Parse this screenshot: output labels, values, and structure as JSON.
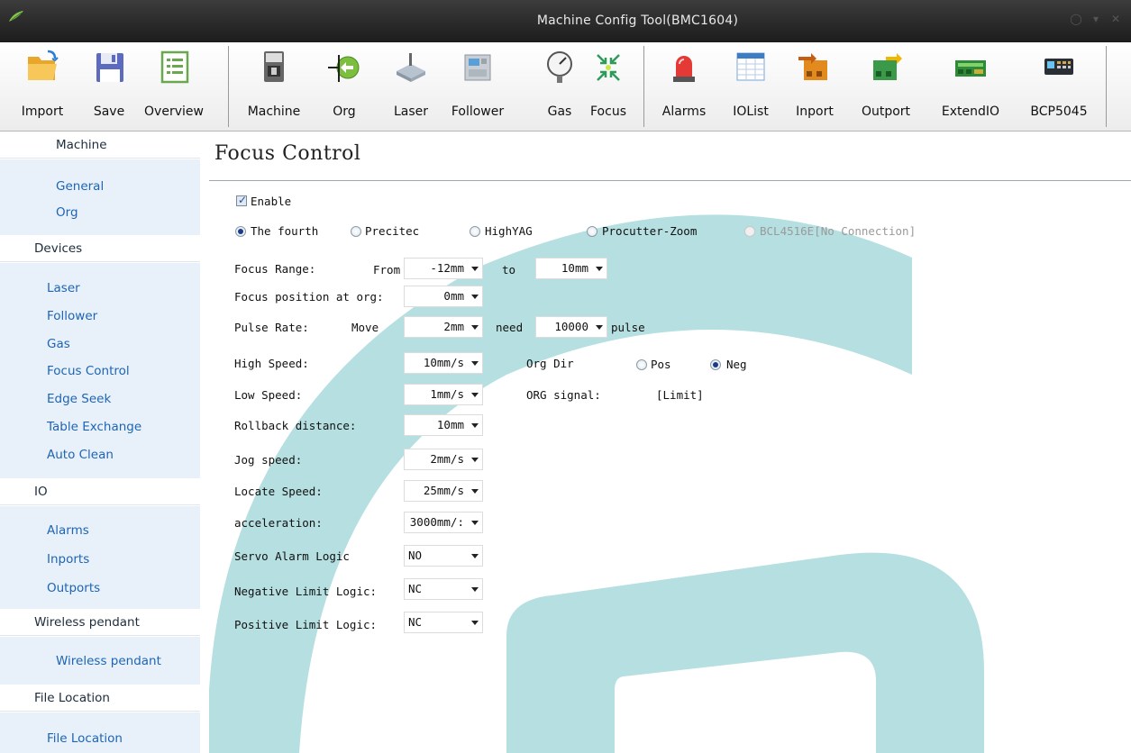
{
  "window": {
    "title": "Machine Config Tool(BMC1604)"
  },
  "toolbar": {
    "buttons": [
      {
        "label": "Import",
        "icon": "folder-open-icon"
      },
      {
        "label": "Save",
        "icon": "floppy-disk-icon"
      },
      {
        "label": "Overview",
        "icon": "list-document-icon"
      },
      {
        "label": "Machine",
        "icon": "machine-icon"
      },
      {
        "label": "Org",
        "icon": "origin-arrow-icon"
      },
      {
        "label": "Laser",
        "icon": "laser-icon"
      },
      {
        "label": "Follower",
        "icon": "follower-device-icon"
      },
      {
        "label": "Gas",
        "icon": "pressure-gauge-icon"
      },
      {
        "label": "Focus",
        "icon": "focus-arrows-icon"
      },
      {
        "label": "Alarms",
        "icon": "alarm-light-icon"
      },
      {
        "label": "IOList",
        "icon": "table-grid-icon"
      },
      {
        "label": "Inport",
        "icon": "inport-terminal-icon"
      },
      {
        "label": "Outport",
        "icon": "outport-terminal-icon"
      },
      {
        "label": "ExtendIO",
        "icon": "circuit-board-icon"
      },
      {
        "label": "BCP5045",
        "icon": "panel-display-icon"
      }
    ]
  },
  "sidebar": {
    "sections": [
      {
        "header": "Machine",
        "items": [
          "General",
          "Org"
        ]
      },
      {
        "header": "Devices",
        "items": [
          "Laser",
          "Follower",
          "Gas",
          "Focus Control",
          "Edge Seek",
          "Table Exchange",
          "Auto Clean"
        ]
      },
      {
        "header": "IO",
        "items": [
          "Alarms",
          "Inports",
          "Outports"
        ]
      },
      {
        "header": "Wireless pendant",
        "items": [
          "Wireless pendant"
        ]
      },
      {
        "header": "File Location",
        "items": [
          "File Location"
        ]
      }
    ]
  },
  "main": {
    "title": "Focus Control",
    "enable_label": "Enable",
    "enable_checked": true,
    "focus_types": [
      {
        "label": "The fourth",
        "selected": true,
        "enabled": true
      },
      {
        "label": "Precitec",
        "selected": false,
        "enabled": true
      },
      {
        "label": "HighYAG",
        "selected": false,
        "enabled": true
      },
      {
        "label": "Procutter-Zoom",
        "selected": false,
        "enabled": true
      },
      {
        "label": "BCL4516E[No Connection]",
        "selected": false,
        "enabled": false
      }
    ],
    "focus_range": {
      "label": "Focus Range:",
      "from_label": "From",
      "from_value": "-12mm",
      "to_label": "to",
      "to_value": "10mm"
    },
    "focus_pos_org": {
      "label": "Focus position at org:",
      "value": "0mm"
    },
    "pulse_rate": {
      "label": "Pulse Rate:",
      "move_label": "Move",
      "move_value": "2mm",
      "need_label": "need",
      "need_value": "10000",
      "pulse_label": "pulse"
    },
    "high_speed": {
      "label": "High Speed:",
      "value": "10mm/s"
    },
    "org_dir": {
      "label": "Org Dir",
      "pos_label": "Pos",
      "neg_label": "Neg",
      "selected": "Neg"
    },
    "low_speed": {
      "label": "Low Speed:",
      "value": "1mm/s"
    },
    "org_signal": {
      "label": "ORG signal:",
      "value": "[Limit]"
    },
    "rollback": {
      "label": "Rollback distance:",
      "value": "10mm"
    },
    "jog_speed": {
      "label": "Jog speed:",
      "value": "2mm/s"
    },
    "locate_speed": {
      "label": "Locate Speed:",
      "value": "25mm/s"
    },
    "acceleration": {
      "label": "acceleration:",
      "value": "3000mm/:"
    },
    "servo_alarm": {
      "label": "Servo Alarm Logic",
      "value": "NO"
    },
    "neg_limit": {
      "label": "Negative Limit Logic:",
      "value": "NC"
    },
    "pos_limit": {
      "label": "Positive Limit Logic:",
      "value": "NC"
    }
  }
}
